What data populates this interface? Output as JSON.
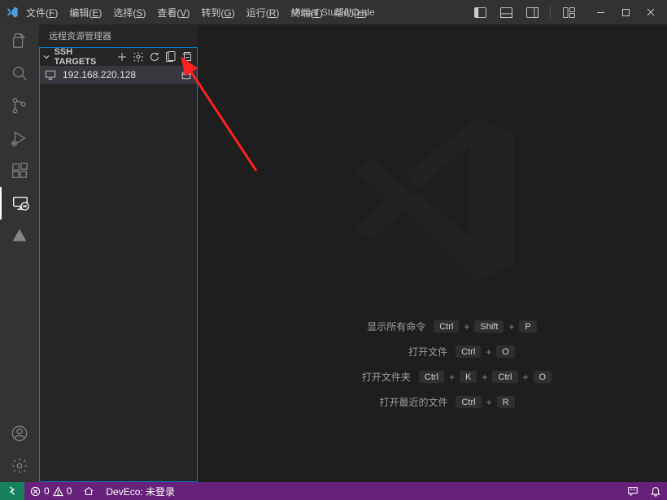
{
  "titlebar": {
    "menu": [
      {
        "text": "文件",
        "mn": "F"
      },
      {
        "text": "编辑",
        "mn": "E"
      },
      {
        "text": "选择",
        "mn": "S"
      },
      {
        "text": "查看",
        "mn": "V"
      },
      {
        "text": "转到",
        "mn": "G"
      },
      {
        "text": "运行",
        "mn": "R"
      },
      {
        "text": "终端",
        "mn": "T"
      },
      {
        "text": "帮助",
        "mn": "H"
      }
    ],
    "title": "Visual Studio Code"
  },
  "sidebar": {
    "title": "远程资源管理器",
    "section_title": "SSH TARGETS",
    "items": [
      {
        "host": "192.168.220.128"
      }
    ]
  },
  "welcome": {
    "rows": [
      {
        "label": "显示所有命令",
        "keys": [
          "Ctrl",
          "Shift",
          "P"
        ]
      },
      {
        "label": "打开文件",
        "keys": [
          "Ctrl",
          "O"
        ]
      },
      {
        "label": "打开文件夹",
        "keys": [
          "Ctrl",
          "K",
          "Ctrl",
          "O"
        ]
      },
      {
        "label": "打开最近的文件",
        "keys": [
          "Ctrl",
          "R"
        ]
      }
    ]
  },
  "statusbar": {
    "errors": "0",
    "warnings": "0",
    "deveco": "DevEco: 未登录"
  }
}
